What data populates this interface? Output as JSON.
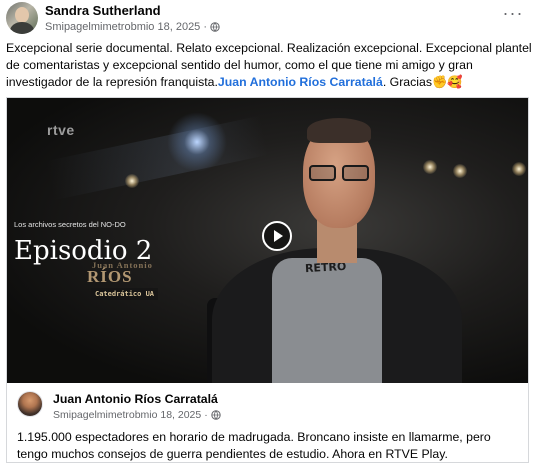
{
  "post": {
    "author": "Sandra Sutherland",
    "date": "Smipagelmimetrobmio 18, 2025",
    "separator": "·",
    "privacy_icon": "globe-icon",
    "more_label": "···",
    "text_main": "Excepcional serie documental. Relato excepcional. Realización excepcional. Excepcional plantel de comentaristas y excepcional sentido del humor, como el que tiene mi amigo y gran investigador de la represión franquista.",
    "mention": "Juan Antonio Ríos Carratalá",
    "text_end": ". Gracias✊🥰"
  },
  "video": {
    "channel_logo": "rtve",
    "series_title": "Los archivos secretos del NO-DO",
    "episode": "Episodio 2",
    "lower_third_name": "Juan Antonio",
    "lower_third_surname": "RÍOS",
    "lower_third_role": "Catedrático UA",
    "shirt_text": "RETRO",
    "play_icon": "play-icon"
  },
  "shared": {
    "author": "Juan Antonio Ríos Carratalá",
    "date": "Smipagelmimetrobmio 18, 2025",
    "separator": "·",
    "privacy_icon": "globe-icon",
    "text": "1.195.000 espectadores en horario de madrugada. Broncano insiste en llamarme, pero tengo muchos consejos de guerra pendientes de estudio. Ahora en RTVE Play."
  },
  "colors": {
    "mention": "#216fdb",
    "secondary_text": "#65676b",
    "border": "#d6d8db"
  }
}
